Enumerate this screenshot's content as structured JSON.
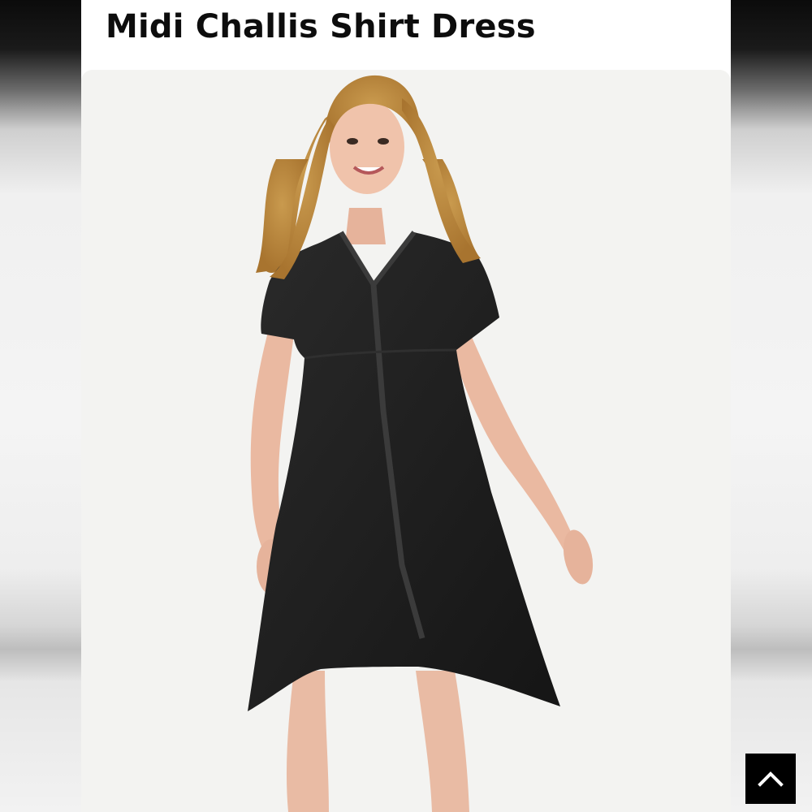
{
  "product": {
    "title": "Midi Challis Shirt Dress"
  },
  "icons": {
    "scroll_top": "chevron-up-icon"
  },
  "colors": {
    "dress": "#1f1f1f",
    "background": "#f3f3f1",
    "button": "#000000"
  }
}
